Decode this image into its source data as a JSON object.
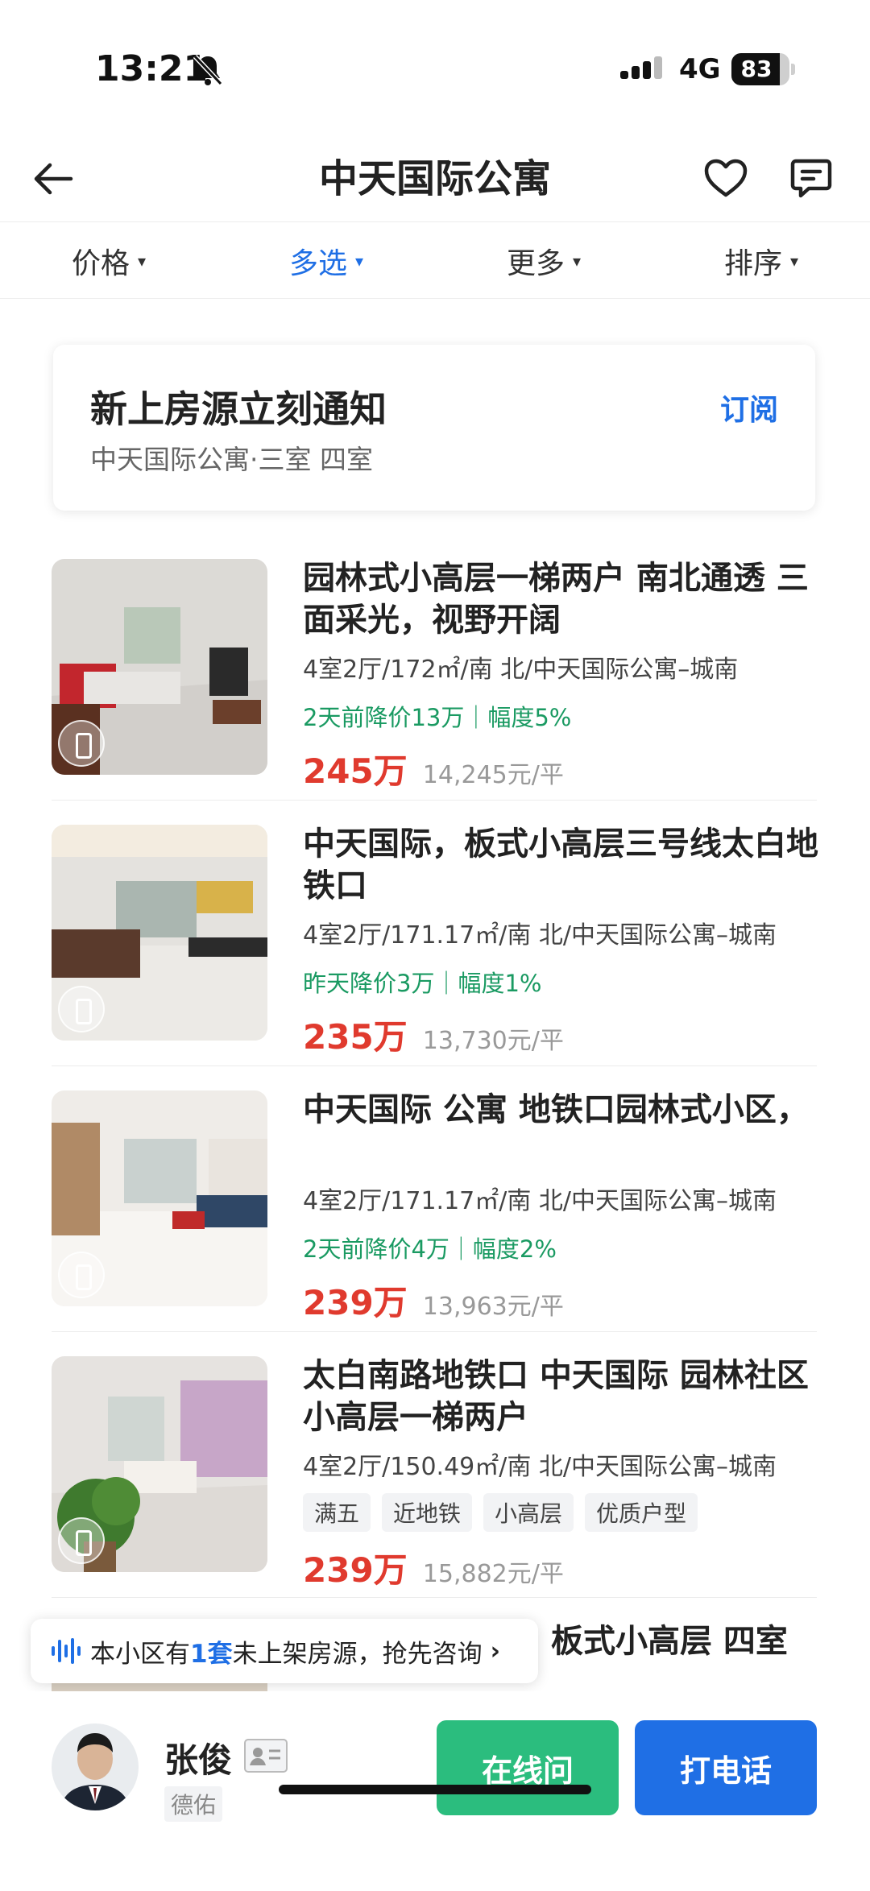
{
  "status": {
    "time": "13:21",
    "network": "4G",
    "battery": "83",
    "battery_level": 0.83
  },
  "header": {
    "title": "中天国际公寓"
  },
  "filters": [
    {
      "label": "价格",
      "active": false
    },
    {
      "label": "多选",
      "active": true
    },
    {
      "label": "更多",
      "active": false
    },
    {
      "label": "排序",
      "active": false
    }
  ],
  "subscribe": {
    "title": "新上房源立刻通知",
    "desc": "中天国际公寓·三室 四室",
    "action": "订阅"
  },
  "listings": [
    {
      "title": "园林式小高层一梯两户 南北通透 三面采光，视野开阔",
      "meta": "4室2厅/172㎡/南 北/中天国际公寓–城南",
      "note": "2天前降价13万｜幅度5%",
      "price": "245万",
      "unit_price": "14,245元/平"
    },
    {
      "title": "中天国际，板式小高层三号线太白地铁口",
      "meta": "4室2厅/171.17㎡/南 北/中天国际公寓–城南",
      "note": "昨天降价3万｜幅度1%",
      "price": "235万",
      "unit_price": "13,730元/平"
    },
    {
      "title": "中天国际 公寓  地铁口园林式小区，",
      "meta": "4室2厅/171.17㎡/南 北/中天国际公寓–城南",
      "note": "2天前降价4万｜幅度2%",
      "price": "239万",
      "unit_price": "13,963元/平"
    },
    {
      "title": "太白南路地铁口 中天国际 园林社区 小高层一梯两户",
      "meta": "4室2厅/150.49㎡/南 北/中天国际公寓–城南",
      "tags": [
        "满五",
        "近地铁",
        "小高层",
        "优质户型"
      ],
      "price": "239万",
      "unit_price": "15,882元/平"
    },
    {
      "title": "板式小高层 四室"
    }
  ],
  "toast": {
    "prefix": "本小区有",
    "count": "1套",
    "suffix": "未上架房源，抢先咨询"
  },
  "agent": {
    "name": "张俊",
    "company": "德佑"
  },
  "actions": {
    "chat": "在线问",
    "call": "打电话"
  },
  "colors": {
    "accent": "#1f6fe5",
    "price": "#e03a2e",
    "discount": "#1a9a62",
    "chat_button": "#2bbd7e"
  }
}
